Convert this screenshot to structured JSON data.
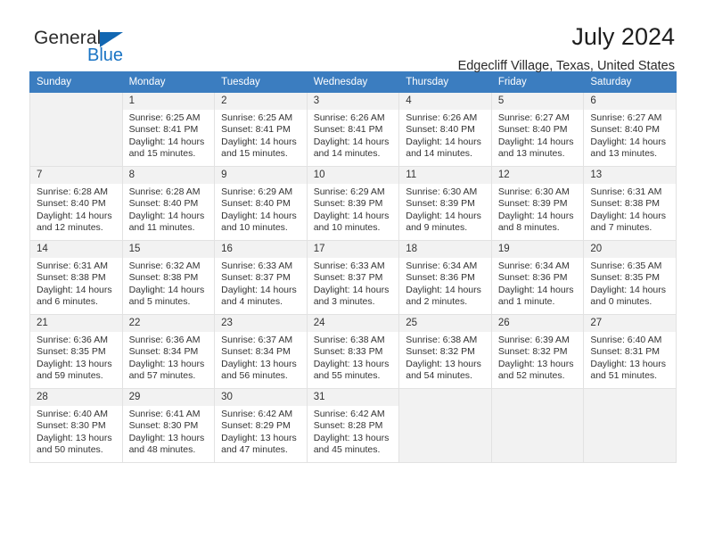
{
  "brand": {
    "name_part1": "General",
    "name_part2": "Blue",
    "triangle_color": "#1267b2",
    "blue_color": "#1a74c4"
  },
  "header": {
    "title": "July 2024",
    "subtitle": "Edgecliff Village, Texas, United States"
  },
  "calendar": {
    "header_bg": "#3b7dc0",
    "header_text_color": "#ffffff",
    "daynum_bg": "#f2f2f2",
    "weekday_headers": [
      "Sunday",
      "Monday",
      "Tuesday",
      "Wednesday",
      "Thursday",
      "Friday",
      "Saturday"
    ],
    "labels": {
      "sunrise": "Sunrise:",
      "sunset": "Sunset:",
      "daylight": "Daylight:"
    },
    "weeks": [
      [
        {
          "day": ""
        },
        {
          "day": "1",
          "sunrise": "Sunrise: 6:25 AM",
          "sunset": "Sunset: 8:41 PM",
          "daylight_line1": "Daylight: 14 hours",
          "daylight_line2": "and 15 minutes."
        },
        {
          "day": "2",
          "sunrise": "Sunrise: 6:25 AM",
          "sunset": "Sunset: 8:41 PM",
          "daylight_line1": "Daylight: 14 hours",
          "daylight_line2": "and 15 minutes."
        },
        {
          "day": "3",
          "sunrise": "Sunrise: 6:26 AM",
          "sunset": "Sunset: 8:41 PM",
          "daylight_line1": "Daylight: 14 hours",
          "daylight_line2": "and 14 minutes."
        },
        {
          "day": "4",
          "sunrise": "Sunrise: 6:26 AM",
          "sunset": "Sunset: 8:40 PM",
          "daylight_line1": "Daylight: 14 hours",
          "daylight_line2": "and 14 minutes."
        },
        {
          "day": "5",
          "sunrise": "Sunrise: 6:27 AM",
          "sunset": "Sunset: 8:40 PM",
          "daylight_line1": "Daylight: 14 hours",
          "daylight_line2": "and 13 minutes."
        },
        {
          "day": "6",
          "sunrise": "Sunrise: 6:27 AM",
          "sunset": "Sunset: 8:40 PM",
          "daylight_line1": "Daylight: 14 hours",
          "daylight_line2": "and 13 minutes."
        }
      ],
      [
        {
          "day": "7",
          "sunrise": "Sunrise: 6:28 AM",
          "sunset": "Sunset: 8:40 PM",
          "daylight_line1": "Daylight: 14 hours",
          "daylight_line2": "and 12 minutes."
        },
        {
          "day": "8",
          "sunrise": "Sunrise: 6:28 AM",
          "sunset": "Sunset: 8:40 PM",
          "daylight_line1": "Daylight: 14 hours",
          "daylight_line2": "and 11 minutes."
        },
        {
          "day": "9",
          "sunrise": "Sunrise: 6:29 AM",
          "sunset": "Sunset: 8:40 PM",
          "daylight_line1": "Daylight: 14 hours",
          "daylight_line2": "and 10 minutes."
        },
        {
          "day": "10",
          "sunrise": "Sunrise: 6:29 AM",
          "sunset": "Sunset: 8:39 PM",
          "daylight_line1": "Daylight: 14 hours",
          "daylight_line2": "and 10 minutes."
        },
        {
          "day": "11",
          "sunrise": "Sunrise: 6:30 AM",
          "sunset": "Sunset: 8:39 PM",
          "daylight_line1": "Daylight: 14 hours",
          "daylight_line2": "and 9 minutes."
        },
        {
          "day": "12",
          "sunrise": "Sunrise: 6:30 AM",
          "sunset": "Sunset: 8:39 PM",
          "daylight_line1": "Daylight: 14 hours",
          "daylight_line2": "and 8 minutes."
        },
        {
          "day": "13",
          "sunrise": "Sunrise: 6:31 AM",
          "sunset": "Sunset: 8:38 PM",
          "daylight_line1": "Daylight: 14 hours",
          "daylight_line2": "and 7 minutes."
        }
      ],
      [
        {
          "day": "14",
          "sunrise": "Sunrise: 6:31 AM",
          "sunset": "Sunset: 8:38 PM",
          "daylight_line1": "Daylight: 14 hours",
          "daylight_line2": "and 6 minutes."
        },
        {
          "day": "15",
          "sunrise": "Sunrise: 6:32 AM",
          "sunset": "Sunset: 8:38 PM",
          "daylight_line1": "Daylight: 14 hours",
          "daylight_line2": "and 5 minutes."
        },
        {
          "day": "16",
          "sunrise": "Sunrise: 6:33 AM",
          "sunset": "Sunset: 8:37 PM",
          "daylight_line1": "Daylight: 14 hours",
          "daylight_line2": "and 4 minutes."
        },
        {
          "day": "17",
          "sunrise": "Sunrise: 6:33 AM",
          "sunset": "Sunset: 8:37 PM",
          "daylight_line1": "Daylight: 14 hours",
          "daylight_line2": "and 3 minutes."
        },
        {
          "day": "18",
          "sunrise": "Sunrise: 6:34 AM",
          "sunset": "Sunset: 8:36 PM",
          "daylight_line1": "Daylight: 14 hours",
          "daylight_line2": "and 2 minutes."
        },
        {
          "day": "19",
          "sunrise": "Sunrise: 6:34 AM",
          "sunset": "Sunset: 8:36 PM",
          "daylight_line1": "Daylight: 14 hours",
          "daylight_line2": "and 1 minute."
        },
        {
          "day": "20",
          "sunrise": "Sunrise: 6:35 AM",
          "sunset": "Sunset: 8:35 PM",
          "daylight_line1": "Daylight: 14 hours",
          "daylight_line2": "and 0 minutes."
        }
      ],
      [
        {
          "day": "21",
          "sunrise": "Sunrise: 6:36 AM",
          "sunset": "Sunset: 8:35 PM",
          "daylight_line1": "Daylight: 13 hours",
          "daylight_line2": "and 59 minutes."
        },
        {
          "day": "22",
          "sunrise": "Sunrise: 6:36 AM",
          "sunset": "Sunset: 8:34 PM",
          "daylight_line1": "Daylight: 13 hours",
          "daylight_line2": "and 57 minutes."
        },
        {
          "day": "23",
          "sunrise": "Sunrise: 6:37 AM",
          "sunset": "Sunset: 8:34 PM",
          "daylight_line1": "Daylight: 13 hours",
          "daylight_line2": "and 56 minutes."
        },
        {
          "day": "24",
          "sunrise": "Sunrise: 6:38 AM",
          "sunset": "Sunset: 8:33 PM",
          "daylight_line1": "Daylight: 13 hours",
          "daylight_line2": "and 55 minutes."
        },
        {
          "day": "25",
          "sunrise": "Sunrise: 6:38 AM",
          "sunset": "Sunset: 8:32 PM",
          "daylight_line1": "Daylight: 13 hours",
          "daylight_line2": "and 54 minutes."
        },
        {
          "day": "26",
          "sunrise": "Sunrise: 6:39 AM",
          "sunset": "Sunset: 8:32 PM",
          "daylight_line1": "Daylight: 13 hours",
          "daylight_line2": "and 52 minutes."
        },
        {
          "day": "27",
          "sunrise": "Sunrise: 6:40 AM",
          "sunset": "Sunset: 8:31 PM",
          "daylight_line1": "Daylight: 13 hours",
          "daylight_line2": "and 51 minutes."
        }
      ],
      [
        {
          "day": "28",
          "sunrise": "Sunrise: 6:40 AM",
          "sunset": "Sunset: 8:30 PM",
          "daylight_line1": "Daylight: 13 hours",
          "daylight_line2": "and 50 minutes."
        },
        {
          "day": "29",
          "sunrise": "Sunrise: 6:41 AM",
          "sunset": "Sunset: 8:30 PM",
          "daylight_line1": "Daylight: 13 hours",
          "daylight_line2": "and 48 minutes."
        },
        {
          "day": "30",
          "sunrise": "Sunrise: 6:42 AM",
          "sunset": "Sunset: 8:29 PM",
          "daylight_line1": "Daylight: 13 hours",
          "daylight_line2": "and 47 minutes."
        },
        {
          "day": "31",
          "sunrise": "Sunrise: 6:42 AM",
          "sunset": "Sunset: 8:28 PM",
          "daylight_line1": "Daylight: 13 hours",
          "daylight_line2": "and 45 minutes."
        },
        {
          "day": ""
        },
        {
          "day": ""
        },
        {
          "day": ""
        }
      ]
    ]
  }
}
